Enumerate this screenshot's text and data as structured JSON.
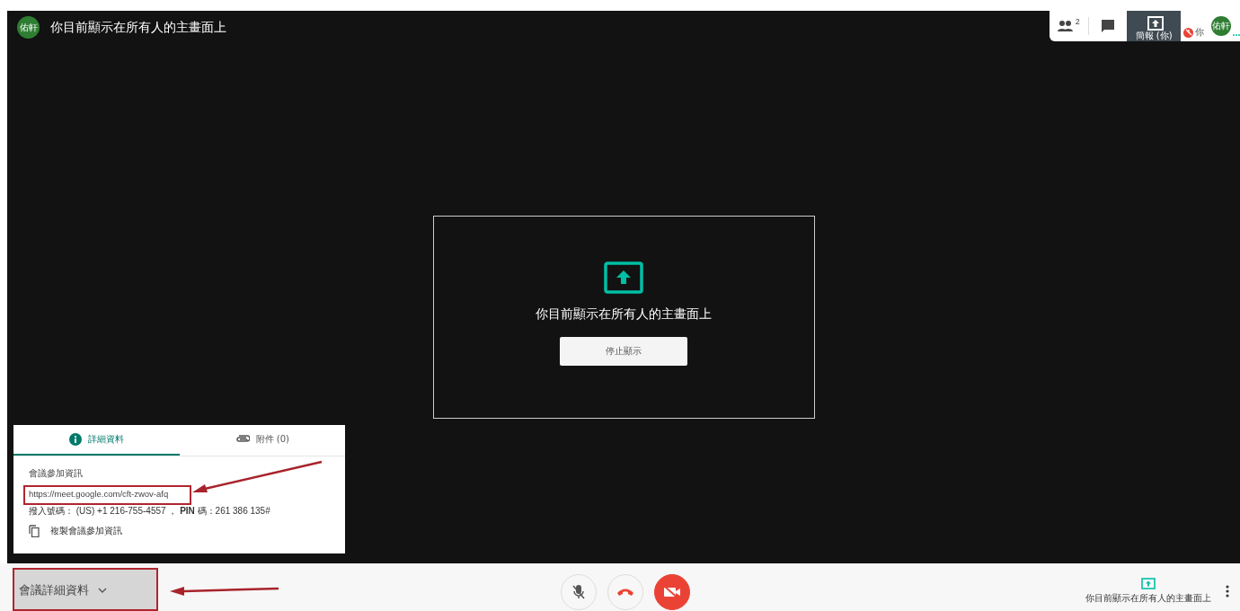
{
  "header": {
    "avatar": "佑軒",
    "title": "你目前顯示在所有人的主畫面上"
  },
  "top_panel": {
    "people_count": "2",
    "tiles": [
      {
        "kind": "presentation",
        "label": "簡報 (你)"
      },
      {
        "kind": "self",
        "label": "你",
        "avatar": "佑軒",
        "muted": true
      }
    ]
  },
  "presenting": {
    "message": "你目前顯示在所有人的主畫面上",
    "button": "停止顯示"
  },
  "details_panel": {
    "tabs": [
      {
        "kind": "info",
        "label": "詳細資料",
        "selected": true
      },
      {
        "kind": "attachment",
        "label": "附件 (0)",
        "selected": false
      }
    ],
    "heading": "會議參加資訊",
    "link": "https://meet.google.com/cft-zwov-afq",
    "dial_in": "撥入號碼：  (US) +1 216-755-4557 ， **PIN** 碼：261 386 135#",
    "copy_label": "複製會議參加資訊"
  },
  "bottom_bar": {
    "details_button": "會議詳細資料",
    "mic_on": false,
    "camera_on": false,
    "presenting_label": "你目前顯示在所有人的主畫面上"
  }
}
